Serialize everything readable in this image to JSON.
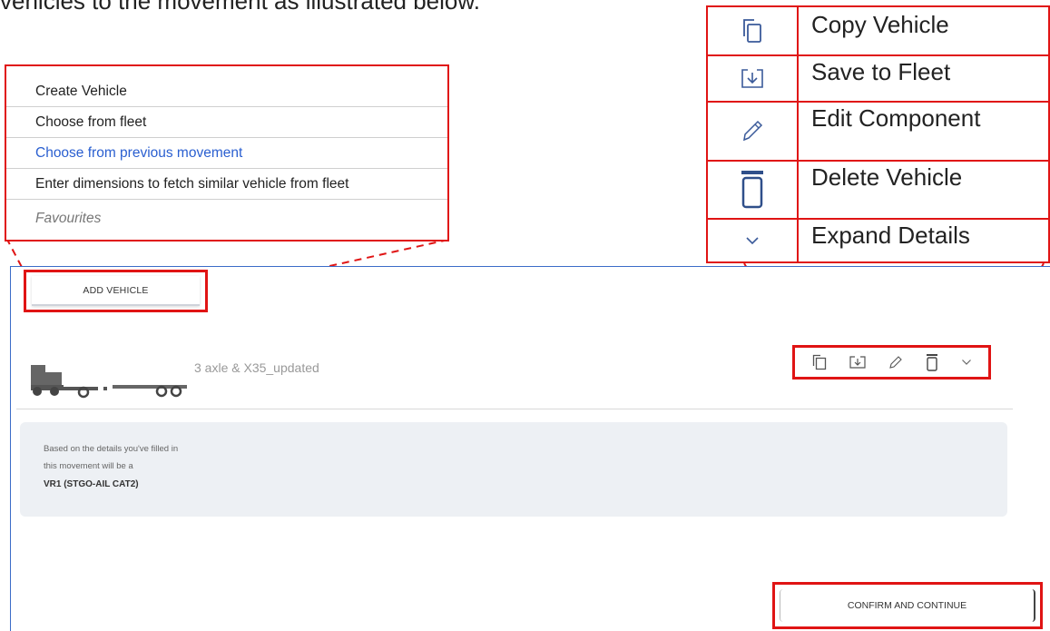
{
  "intro": {
    "text": "vehicles to the movement as illustrated below."
  },
  "dropdown": {
    "items": [
      {
        "label": "Create Vehicle"
      },
      {
        "label": "Choose from fleet"
      },
      {
        "label": "Choose from previous movement"
      },
      {
        "label": "Enter dimensions to fetch similar vehicle from fleet"
      },
      {
        "label": "Favourites"
      }
    ]
  },
  "legend": {
    "rows": [
      {
        "icon": "copy-icon",
        "label": "Copy Vehicle"
      },
      {
        "icon": "save-to-fleet-icon",
        "label": "Save to Fleet"
      },
      {
        "icon": "pencil-icon",
        "label": "Edit Component"
      },
      {
        "icon": "trash-icon",
        "label": "Delete Vehicle"
      },
      {
        "icon": "chevron-down-icon",
        "label": "Expand Details"
      }
    ]
  },
  "panel": {
    "add_vehicle_label": "ADD VEHICLE",
    "vehicle_name": "3 axle & X35_updated",
    "info": {
      "line1": "Based on the details you've filled in",
      "line2": "this movement will be a",
      "line3": "VR1 (STGO-AIL CAT2)"
    },
    "confirm_label": "CONFIRM AND CONTINUE"
  },
  "colors": {
    "highlight": "#e01414",
    "link": "#2a5fd0",
    "panel_border": "#3b6cc8",
    "info_bg": "#edf0f4"
  }
}
